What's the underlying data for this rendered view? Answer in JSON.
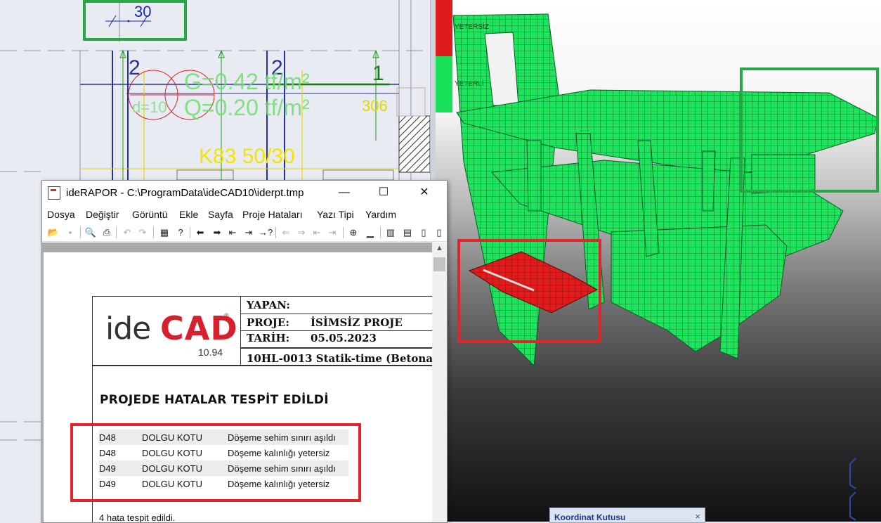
{
  "plan": {
    "dim_value": "30",
    "axis_labels": [
      "2",
      "2",
      "1"
    ],
    "slab_text_1": "G=0.42 tf/m²",
    "slab_text_2": "Q=0.20 tf/m²",
    "slab_text_3": "d=10",
    "slab_text_4": "306",
    "beam_label": "K83 50/30"
  },
  "view3d": {
    "legend_insufficient": "YETERSİZ",
    "legend_sufficient": "YETERLİ",
    "colors": {
      "insufficient": "#e01b1b",
      "sufficient": "#19e25a"
    }
  },
  "coord_box": {
    "title": "Koordinat Kutusu",
    "close": "×"
  },
  "window": {
    "title": "ideRAPOR - C:\\ProgramData\\ideCAD10\\iderpt.tmp",
    "controls": {
      "minimize": "—",
      "maximize": "☐",
      "close": "✕"
    },
    "menu": [
      "Dosya",
      "Değiştir",
      "Görüntü",
      "Ekle",
      "Sayfa",
      "Proje Hataları",
      "Yazı Tipi",
      "Yardım"
    ],
    "toolbar_icons": [
      "open-icon",
      "save-icon",
      "print-preview-icon",
      "print-icon",
      "undo-icon",
      "redo-icon",
      "calculator-icon",
      "help-icon",
      "arrow-left-icon",
      "arrow-right-icon",
      "first-icon",
      "last-icon",
      "next-error-icon"
    ]
  },
  "report": {
    "logo": {
      "ide": "ide",
      "cad": "CAD",
      "reg": "®",
      "version": "10.94"
    },
    "header": {
      "yapan_label": "YAPAN:",
      "yapan_value": "",
      "proje_label": "PROJE:",
      "proje_value": "İSİMSİZ PROJE",
      "tarih_label": "TARİH:",
      "tarih_value": "05.05.2023",
      "license": "10HL-0013 Statik-time (Betona"
    },
    "error_title": "PROJEDE HATALAR TESPİT EDİLDİ",
    "errors": [
      {
        "id": "D48",
        "type": "DOLGU KOTU",
        "msg": "Döşeme sehim sınırı aşıldı"
      },
      {
        "id": "D48",
        "type": "DOLGU KOTU",
        "msg": "Döşeme kalınlığı yetersiz"
      },
      {
        "id": "D49",
        "type": "DOLGU KOTU",
        "msg": "Döşeme sehim sınırı aşıldı"
      },
      {
        "id": "D49",
        "type": "DOLGU KOTU",
        "msg": "Döşeme kalınlığı yetersiz"
      }
    ],
    "summary": "4 hata tespit edildi."
  }
}
